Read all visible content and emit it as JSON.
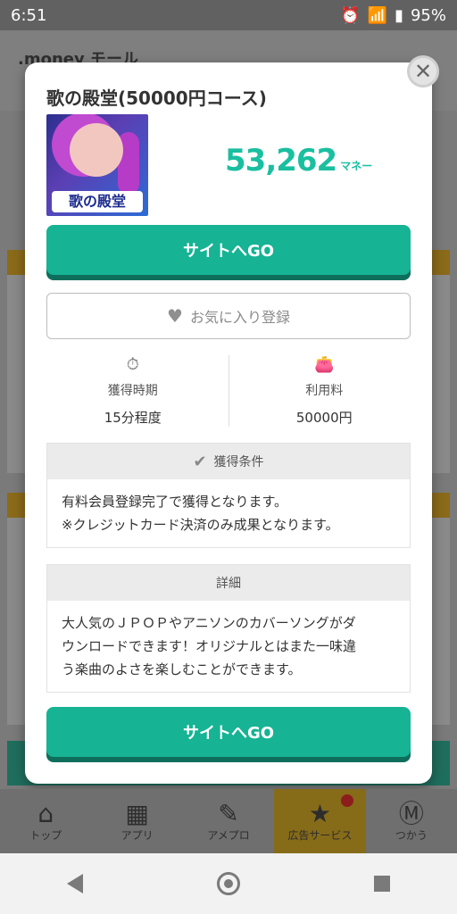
{
  "status": {
    "time": "6:51",
    "battery": "95%"
  },
  "background": {
    "logo": ".money モール"
  },
  "modal": {
    "close": "✕",
    "title": "歌の殿堂(50000円コース)",
    "thumbnail_text": "歌の殿堂",
    "reward_value": "53,262",
    "reward_unit": "マネー",
    "go_button_label": "サイトへGO",
    "favorite_label": "お気に入り登録",
    "stats": [
      {
        "label": "獲得時期",
        "value": "15分程度"
      },
      {
        "label": "利用料",
        "value": "50000円"
      }
    ],
    "conditions": {
      "title": "獲得条件",
      "lines": [
        "有料会員登録完了で獲得となります。",
        "※クレジットカード決済のみ成果となります。"
      ]
    },
    "details": {
      "title": "詳細",
      "lines": [
        "大人気のＪＰＯＰやアニソンのカバーソングがダ",
        "ウンロードできます！オリジナルとはまた一味違",
        "う楽曲のよさを楽しむことができます。"
      ]
    }
  },
  "tabbar": {
    "items": [
      {
        "label": "トップ"
      },
      {
        "label": "アプリ"
      },
      {
        "label": "アメプロ"
      },
      {
        "label": "広告サービス"
      },
      {
        "label": "つかう"
      }
    ]
  }
}
